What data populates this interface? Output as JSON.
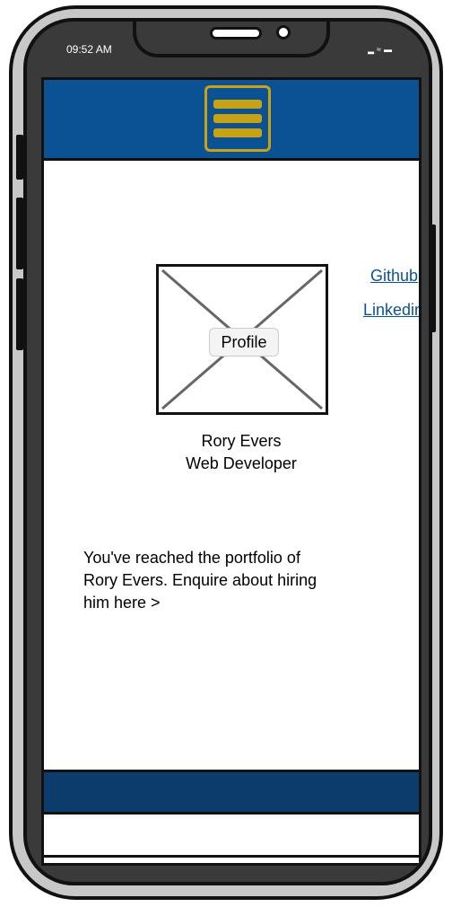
{
  "status_bar": {
    "time": "09:52 AM",
    "icons": "▮ • ▬"
  },
  "header": {
    "menu_icon": "hamburger-menu-icon"
  },
  "profile": {
    "image_label": "Profile",
    "name": "Rory Evers",
    "role": "Web Developer"
  },
  "links": {
    "github": "Github",
    "linkedin": "Linkedin"
  },
  "intro": {
    "line1": "You've reached the portfolio of",
    "line2": "Rory Evers. Enquire about hiring",
    "line3": "him here >"
  },
  "colors": {
    "nav_blue": "#0b5294",
    "footer_blue": "#0b3c6c",
    "menu_gold": "#c8a212",
    "link_blue": "#0b5294"
  }
}
